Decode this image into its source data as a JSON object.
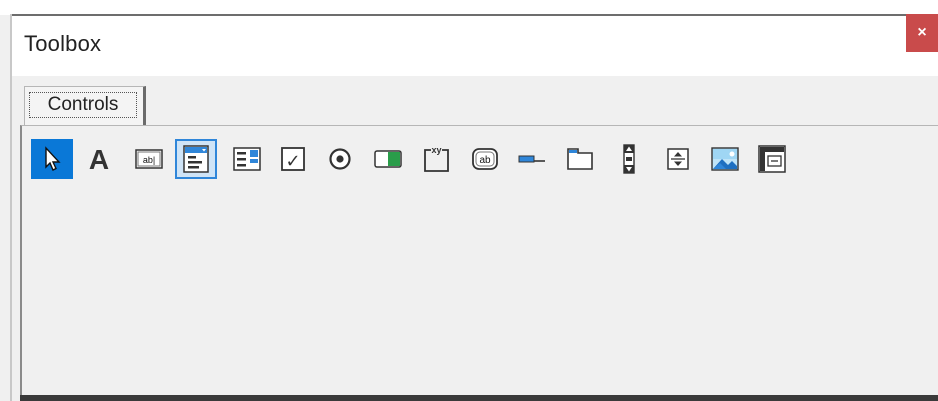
{
  "window": {
    "title": "Toolbox",
    "close_label": "×"
  },
  "tabs": [
    {
      "label": "Controls",
      "active": true
    }
  ],
  "tools": [
    {
      "icon": "select-objects-icon",
      "selected": true
    },
    {
      "icon": "label-icon",
      "glyph": "A"
    },
    {
      "icon": "textbox-icon",
      "glyph": "ab|"
    },
    {
      "icon": "combobox-icon",
      "highlighted": true
    },
    {
      "icon": "listbox-icon"
    },
    {
      "icon": "checkbox-icon",
      "glyph": "✓"
    },
    {
      "icon": "optionbutton-icon"
    },
    {
      "icon": "togglebutton-icon"
    },
    {
      "icon": "frame-icon",
      "glyph": "xy"
    },
    {
      "icon": "commandbutton-icon",
      "glyph": "ab"
    },
    {
      "icon": "tabstrip-icon"
    },
    {
      "icon": "multipage-icon"
    },
    {
      "icon": "scrollbar-icon"
    },
    {
      "icon": "spinbutton-icon"
    },
    {
      "icon": "image-icon"
    },
    {
      "icon": "refedit-icon"
    }
  ],
  "colors": {
    "selection": "#0a78d7",
    "close_button": "#c94b4b",
    "toggle_green": "#2a9d4a",
    "panel_background": "#f0f0f0"
  }
}
